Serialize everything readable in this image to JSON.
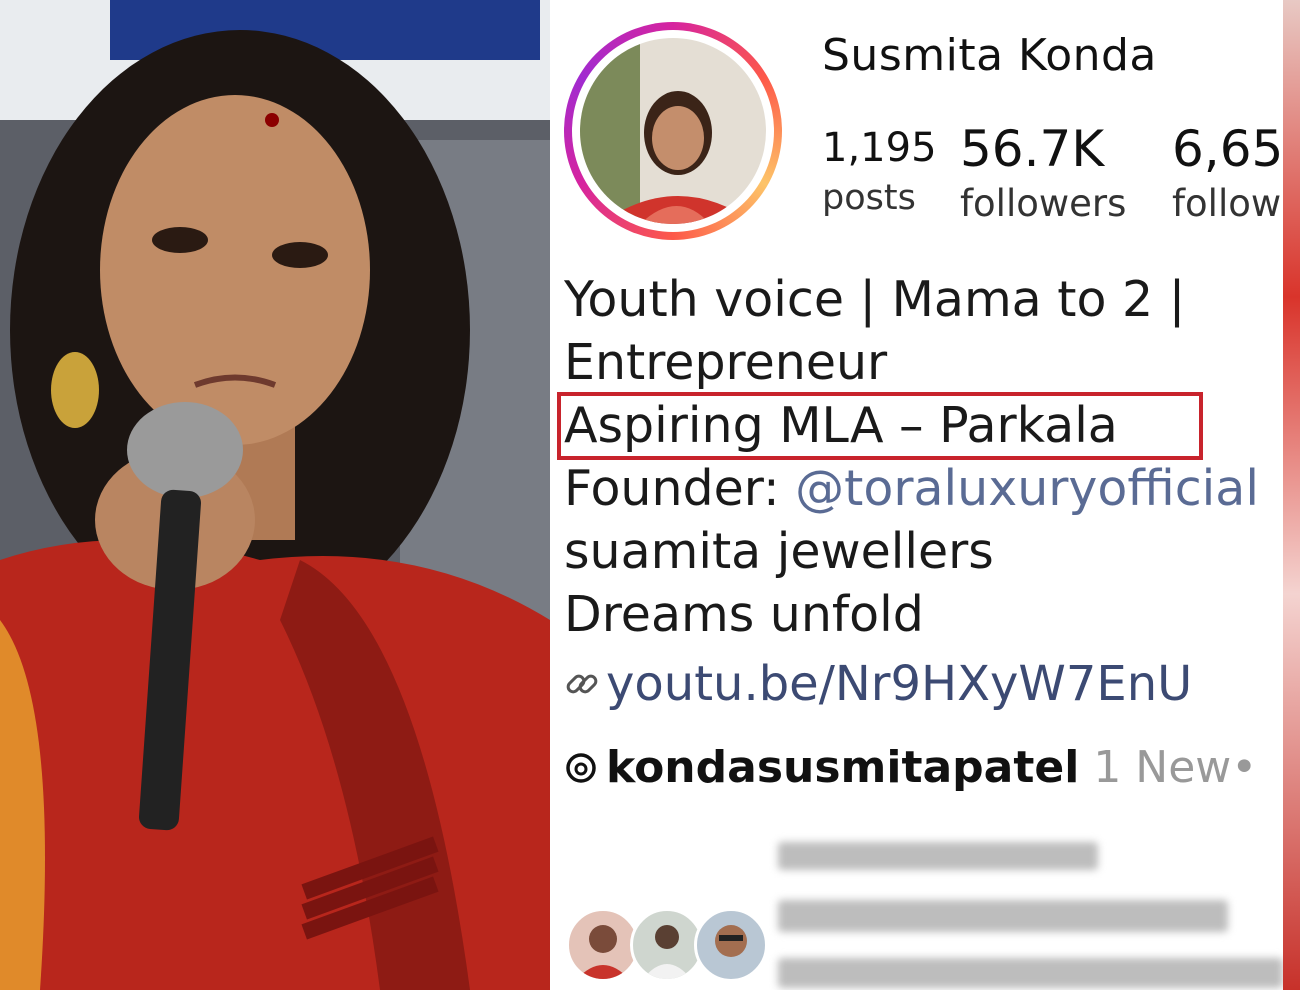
{
  "profile": {
    "username": "Susmita Konda",
    "stats": {
      "posts_count": "1,195",
      "posts_label": "posts",
      "followers_count": "56.7K",
      "followers_label": "followers",
      "following_count": "6,65",
      "following_label": "follow"
    },
    "bio_lines": [
      "Youth voice | Mama to 2 |",
      "Entrepreneur",
      "Aspiring MLA – Parkala"
    ],
    "founder_prefix": "Founder: ",
    "founder_mention": "@toraluxuryofficial",
    "bio_extra": [
      "suamita jewellers",
      "Dreams unfold"
    ],
    "link_text": "youtu.be/Nr9HXyW7EnU",
    "threads_handle": "kondasusmitapatel",
    "threads_badge": "1 New•"
  },
  "icons": {
    "link": "link-icon",
    "threads": "threads-icon"
  },
  "colors": {
    "highlight_border": "#c8232c",
    "mention": "#5a6b94",
    "link": "#3c4a73"
  }
}
